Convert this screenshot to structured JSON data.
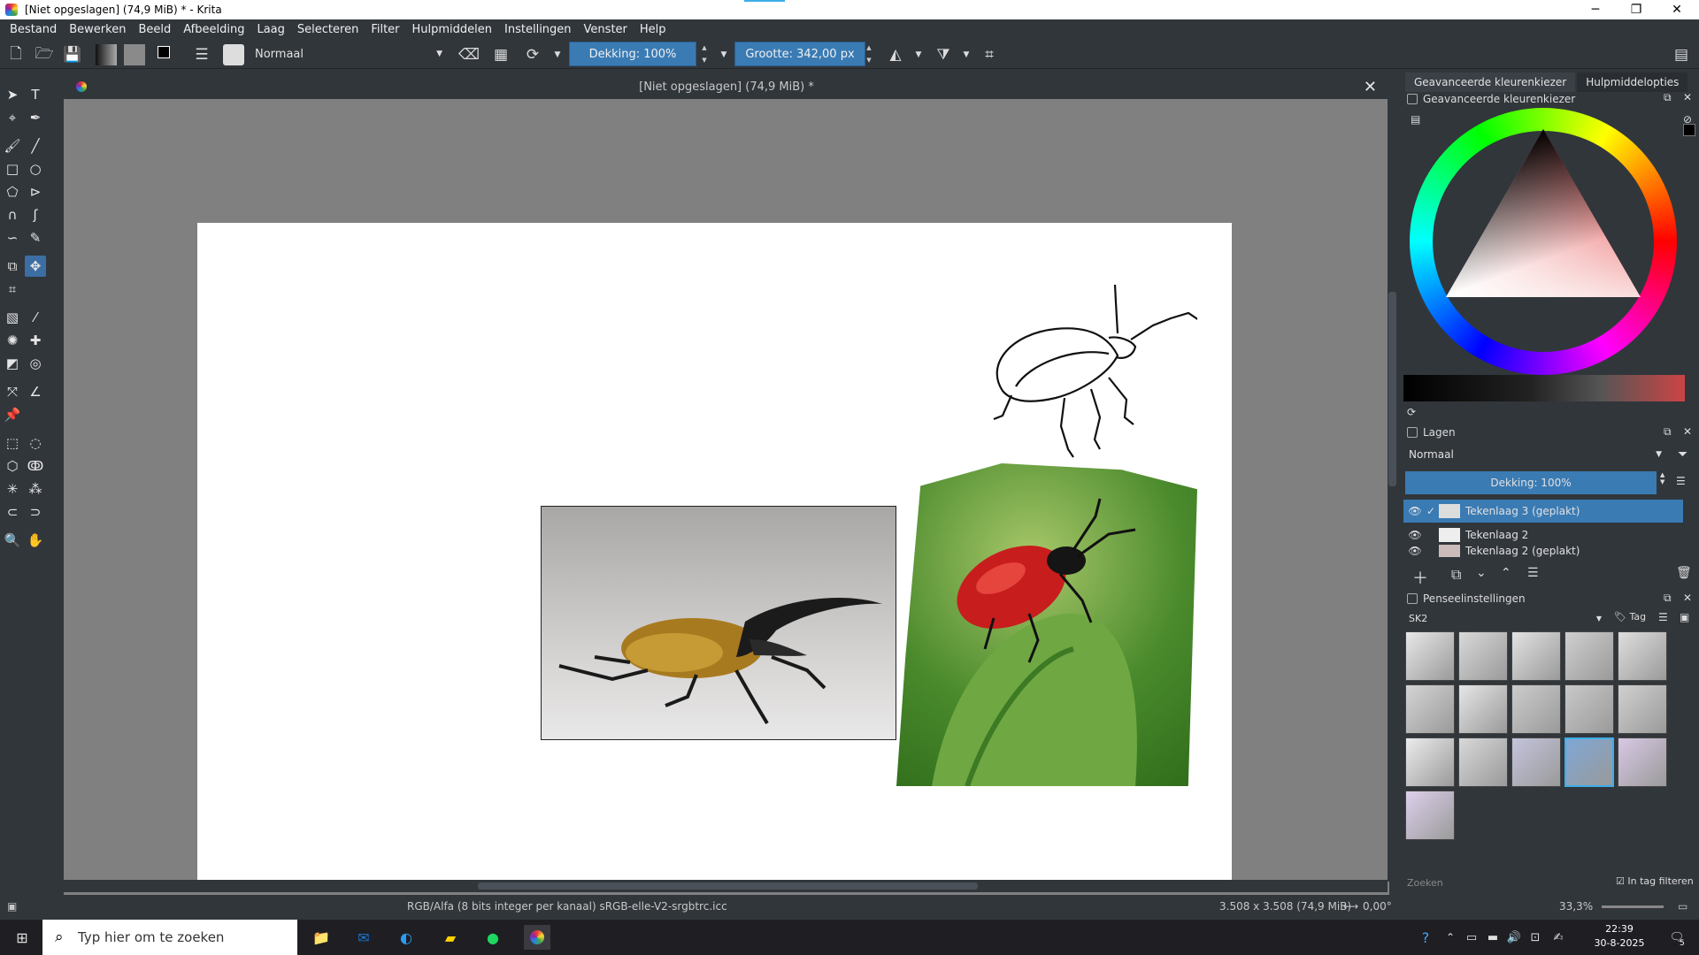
{
  "window": {
    "title": "[Niet opgeslagen]  (74,9 MiB) * - Krita",
    "minimize": "─",
    "maximize": "❐",
    "close": "✕"
  },
  "menu": [
    "Bestand",
    "Bewerken",
    "Beeld",
    "Afbeelding",
    "Laag",
    "Selecteren",
    "Filter",
    "Hulpmiddelen",
    "Instellingen",
    "Venster",
    "Help"
  ],
  "toolbar": {
    "blend_mode": "Normaal",
    "opacity": "Dekking: 100%",
    "size": "Grootte: 342,00 px"
  },
  "document": {
    "tab_title": "[Niet opgeslagen]  (74,9 MiB) *",
    "close": "✕"
  },
  "dockers": {
    "tabs": [
      "Geavanceerde kleurenkiezer",
      "Hulpmiddelopties"
    ],
    "color_selector": {
      "title": "Geavanceerde kleurenkiezer"
    },
    "layers": {
      "title": "Lagen",
      "blend_mode": "Normaal",
      "opacity": "Dekking:  100%",
      "items": [
        {
          "name": "Tekenlaag 3 (geplakt)",
          "selected": true
        },
        {
          "name": "Tekenlaag 2",
          "selected": false
        },
        {
          "name": "Tekenlaag 2 (geplakt)",
          "selected": false
        }
      ]
    },
    "brushes": {
      "title": "Penseelinstellingen",
      "preset_tag": "SK2",
      "tag_label": "Tag",
      "search_placeholder": "Zoeken",
      "filter_label": "In tag filteren"
    }
  },
  "status": {
    "color_space": "RGB/Alfa (8 bits integer per kanaal)  sRGB-elle-V2-srgbtrc.icc",
    "dimensions": "3.508 x 3.508 (74,9 MiB)",
    "rotation": "0,00°",
    "zoom": "33,3%"
  },
  "taskbar": {
    "search_placeholder": "Typ hier om te zoeken",
    "time": "22:39",
    "date": "30-8-2025",
    "notifications": "5"
  }
}
